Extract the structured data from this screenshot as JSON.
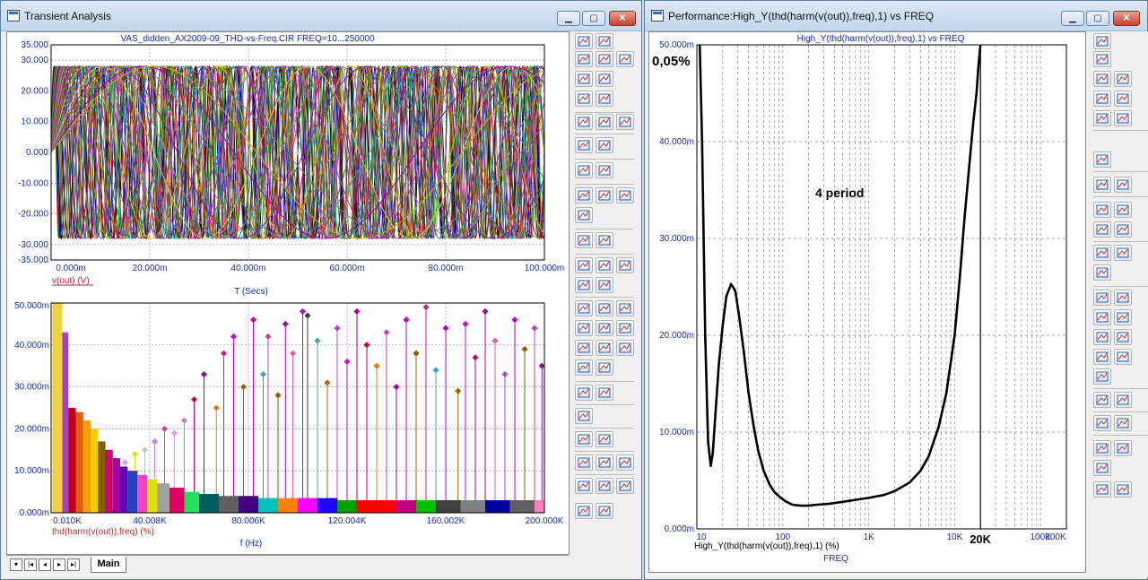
{
  "left_window": {
    "title": "Transient Analysis",
    "controls": {
      "minimize": "▁",
      "maximize": "▢",
      "close": "✕"
    },
    "tab_label": "Main"
  },
  "right_window": {
    "title": "Performance:High_Y(thd(harm(v(out)),freq),1) vs FREQ",
    "controls": {
      "minimize": "▁",
      "maximize": "▢",
      "close": "✕"
    }
  },
  "colors": {
    "axis_text": "#1d2ea8",
    "grid": "#888888",
    "trace_label": "#c0282f"
  },
  "chart_data": [
    {
      "id": "transient",
      "type": "line",
      "title": "VAS_didden_AX2009-09_THD-vs-Freq.CIR FREQ=10...250000",
      "xlabel": "T (Secs)",
      "ylabel": "",
      "trace_label": "v(out) (V)",
      "xlim": [
        0,
        100
      ],
      "ylim": [
        -35,
        35
      ],
      "x_tick_labels": [
        "0.000m",
        "20.000m",
        "40.000m",
        "60.000m",
        "80.000m",
        "100.000m"
      ],
      "y_tick_labels": [
        "35.000",
        "30.000",
        "20.000",
        "10.000",
        "0.000",
        "-10.000",
        "-20.000",
        "-30.000",
        "-35.000"
      ],
      "series": [
        {
          "color": "#00c000",
          "freq": 500,
          "amplitude": 28
        },
        {
          "color": "#e00000",
          "freq": 450,
          "amplitude": 28
        },
        {
          "color": "#0000e0",
          "freq": 400,
          "amplitude": 28
        },
        {
          "color": "#000000",
          "freq": 350,
          "amplitude": 28
        },
        {
          "color": "#606060",
          "freq": 300,
          "amplitude": 28
        },
        {
          "color": "#808000",
          "freq": 260,
          "amplitude": 28
        },
        {
          "color": "#1a1a1a",
          "freq": 220,
          "amplitude": 28
        },
        {
          "color": "#9a9a9a",
          "freq": 190,
          "amplitude": 28
        },
        {
          "color": "#6a6a6a",
          "freq": 165,
          "amplitude": 28
        },
        {
          "color": "#404040",
          "freq": 145,
          "amplitude": 28
        },
        {
          "color": "#a00040",
          "freq": 128,
          "amplitude": 28
        },
        {
          "color": "#20a0a0",
          "freq": 115,
          "amplitude": 28
        },
        {
          "color": "#c040c0",
          "freq": 103,
          "amplitude": 28
        },
        {
          "color": "#806000",
          "freq": 92,
          "amplitude": 28
        },
        {
          "color": "#e060a0",
          "freq": 82,
          "amplitude": 28
        },
        {
          "color": "#2060a0",
          "freq": 73,
          "amplitude": 28
        },
        {
          "color": "#c0a000",
          "freq": 65,
          "amplitude": 28
        },
        {
          "color": "#b000b0",
          "freq": 58,
          "amplitude": 28
        },
        {
          "color": "#c06000",
          "freq": 52,
          "amplitude": 28
        },
        {
          "color": "#00a060",
          "freq": 46,
          "amplitude": 28
        },
        {
          "color": "#a03080",
          "freq": 41,
          "amplitude": 28
        },
        {
          "color": "#c0c000",
          "freq": 37,
          "amplitude": 28
        },
        {
          "color": "#505090",
          "freq": 33,
          "amplitude": 28
        },
        {
          "color": "#3090b0",
          "freq": 29.5,
          "amplitude": 28
        },
        {
          "color": "#b030b0",
          "freq": 26.5,
          "amplitude": 28
        },
        {
          "color": "#d0d040",
          "freq": 24,
          "amplitude": 28
        },
        {
          "color": "#909090",
          "freq": 21.5,
          "amplitude": 28
        },
        {
          "color": "#6a3090",
          "freq": 19.5,
          "amplitude": 28
        },
        {
          "color": "#b08000",
          "freq": 17.5,
          "amplitude": 28
        },
        {
          "color": "#4a8aa0",
          "freq": 15.5,
          "amplitude": 28
        },
        {
          "color": "#a000a0",
          "freq": 13.5,
          "amplitude": 28
        },
        {
          "color": "#c8b400",
          "freq": 12,
          "amplitude": 28
        },
        {
          "color": "#808080",
          "freq": 10.5,
          "amplitude": 28
        }
      ]
    },
    {
      "id": "harmonics",
      "type": "bar",
      "title": "",
      "xlabel": "f (Hz)",
      "ylabel": "",
      "trace_label": "thd(harm(v(out)),freq) (%)",
      "xlim": [
        0,
        200
      ],
      "ylim": [
        0,
        50
      ],
      "x_tick_labels": [
        "0.010K",
        "40.008K",
        "80.006K",
        "120.004K",
        "160.002K",
        "200.000K"
      ],
      "y_tick_labels": [
        "50.000m",
        "40.000m",
        "30.000m",
        "20.000m",
        "10.000m",
        "0.000m"
      ],
      "bars": [
        {
          "x": 0.5,
          "value": 50,
          "color": "#f0d040"
        },
        {
          "x": 4.5,
          "value": 43,
          "color": "#a040d0"
        },
        {
          "x": 7,
          "value": 25,
          "color": "#c00020"
        },
        {
          "x": 10,
          "value": 24,
          "color": "#e06000"
        },
        {
          "x": 13,
          "value": 22,
          "color": "#f0a000"
        },
        {
          "x": 16,
          "value": 20,
          "color": "#f0d000"
        },
        {
          "x": 19,
          "value": 17,
          "color": "#806000"
        },
        {
          "x": 22,
          "value": 15,
          "color": "#d00070"
        },
        {
          "x": 25,
          "value": 13,
          "color": "#a000a0"
        },
        {
          "x": 28,
          "value": 11,
          "color": "#6000b0"
        },
        {
          "x": 31,
          "value": 10,
          "color": "#2040c0"
        },
        {
          "x": 35,
          "value": 9,
          "color": "#ff40c0"
        },
        {
          "x": 39,
          "value": 8,
          "color": "#e0e000"
        },
        {
          "x": 43,
          "value": 7,
          "color": "#a0a0a0"
        },
        {
          "x": 48,
          "value": 6,
          "color": "#e00060"
        },
        {
          "x": 54,
          "value": 5,
          "color": "#20e060"
        },
        {
          "x": 60,
          "value": 4.5,
          "color": "#006060"
        },
        {
          "x": 68,
          "value": 4,
          "color": "#606060"
        },
        {
          "x": 76,
          "value": 4,
          "color": "#400080"
        },
        {
          "x": 84,
          "value": 3.5,
          "color": "#00c0c0"
        },
        {
          "x": 92,
          "value": 3.5,
          "color": "#ff8000"
        },
        {
          "x": 100,
          "value": 3.5,
          "color": "#ff00ff"
        },
        {
          "x": 108,
          "value": 3.5,
          "color": "#2000ff"
        },
        {
          "x": 116,
          "value": 3,
          "color": "#00a000"
        },
        {
          "x": 124,
          "value": 3,
          "color": "#ff0000"
        },
        {
          "x": 132,
          "value": 3,
          "color": "#ff0000"
        },
        {
          "x": 140,
          "value": 3,
          "color": "#c00080"
        },
        {
          "x": 148,
          "value": 3,
          "color": "#00c000"
        },
        {
          "x": 156,
          "value": 3,
          "color": "#404040"
        },
        {
          "x": 166,
          "value": 3,
          "color": "#808080"
        },
        {
          "x": 176,
          "value": 3,
          "color": "#0000a0"
        },
        {
          "x": 186,
          "value": 3,
          "color": "#606060"
        },
        {
          "x": 196,
          "value": 3,
          "color": "#ff80c0"
        }
      ],
      "stems": [
        {
          "x": 58,
          "value": 27,
          "color": "#c00060"
        },
        {
          "x": 62,
          "value": 33,
          "color": "#a000a0"
        },
        {
          "x": 67,
          "value": 25,
          "color": "#e08000"
        },
        {
          "x": 70,
          "value": 38,
          "color": "#c02080"
        },
        {
          "x": 74,
          "value": 42,
          "color": "#d000d0"
        },
        {
          "x": 78,
          "value": 30,
          "color": "#a06000"
        },
        {
          "x": 82,
          "value": 46,
          "color": "#c000c0"
        },
        {
          "x": 86,
          "value": 33,
          "color": "#40a0c0"
        },
        {
          "x": 88,
          "value": 42,
          "color": "#d040a0"
        },
        {
          "x": 92,
          "value": 28,
          "color": "#806000"
        },
        {
          "x": 95,
          "value": 45,
          "color": "#a000a0"
        },
        {
          "x": 98,
          "value": 38,
          "color": "#e060a0"
        },
        {
          "x": 102,
          "value": 48,
          "color": "#c000c0"
        },
        {
          "x": 104,
          "value": 47,
          "color": "#404040"
        },
        {
          "x": 108,
          "value": 41,
          "color": "#40a0c0"
        },
        {
          "x": 112,
          "value": 31,
          "color": "#c06000"
        },
        {
          "x": 116,
          "value": 44,
          "color": "#c040c0"
        },
        {
          "x": 120,
          "value": 36,
          "color": "#d000d0"
        },
        {
          "x": 124,
          "value": 48,
          "color": "#a000a0"
        },
        {
          "x": 128,
          "value": 40,
          "color": "#c00060"
        },
        {
          "x": 132,
          "value": 35,
          "color": "#e08000"
        },
        {
          "x": 136,
          "value": 43,
          "color": "#d040a0"
        },
        {
          "x": 140,
          "value": 30,
          "color": "#a000a0"
        },
        {
          "x": 144,
          "value": 46,
          "color": "#c000c0"
        },
        {
          "x": 148,
          "value": 38,
          "color": "#806000"
        },
        {
          "x": 152,
          "value": 49,
          "color": "#c02080"
        },
        {
          "x": 156,
          "value": 34,
          "color": "#40a0c0"
        },
        {
          "x": 160,
          "value": 44,
          "color": "#c000c0"
        },
        {
          "x": 165,
          "value": 29,
          "color": "#a06000"
        },
        {
          "x": 168,
          "value": 45,
          "color": "#d000d0"
        },
        {
          "x": 172,
          "value": 37,
          "color": "#c00060"
        },
        {
          "x": 176,
          "value": 48,
          "color": "#a000a0"
        },
        {
          "x": 180,
          "value": 41,
          "color": "#e060a0"
        },
        {
          "x": 184,
          "value": 33,
          "color": "#c040c0"
        },
        {
          "x": 188,
          "value": 46,
          "color": "#c000c0"
        },
        {
          "x": 192,
          "value": 39,
          "color": "#806000"
        },
        {
          "x": 196,
          "value": 44,
          "color": "#d040a0"
        },
        {
          "x": 199,
          "value": 35,
          "color": "#a000a0"
        },
        {
          "x": 22,
          "value": 13,
          "color": "#d080d0"
        },
        {
          "x": 30,
          "value": 12,
          "color": "#e0a0e0"
        },
        {
          "x": 34,
          "value": 14,
          "color": "#e0e000"
        },
        {
          "x": 38,
          "value": 15,
          "color": "#c0c0c0"
        },
        {
          "x": 42,
          "value": 17,
          "color": "#d080d0"
        },
        {
          "x": 46,
          "value": 20,
          "color": "#d040a0"
        },
        {
          "x": 50,
          "value": 19,
          "color": "#e0a0e0"
        },
        {
          "x": 54,
          "value": 22,
          "color": "#c080c0"
        }
      ]
    },
    {
      "id": "performance",
      "type": "line",
      "title": "High_Y(thd(harm(v(out)),freq),1) vs FREQ",
      "xlabel": "FREQ",
      "ylabel": "",
      "trace_label": "High_Y(thd(harm(v(out)),freq),1) (%)",
      "x_scale": "log",
      "xlim": [
        10,
        200000
      ],
      "ylim": [
        0,
        50
      ],
      "x_tick_labels": [
        "10",
        "100",
        "1K",
        "10K",
        "100K",
        "200K"
      ],
      "y_tick_labels": [
        "50.000m",
        "40.000m",
        "30.000m",
        "20.000m",
        "10.000m",
        "0.000m"
      ],
      "annotations": {
        "top_left": "0,05%",
        "middle": "4 period",
        "marker": "20K"
      },
      "marker_x": 20000,
      "x": [
        10.8,
        11.5,
        12.5,
        13.5,
        14.5,
        15.3,
        16.5,
        18,
        20,
        22,
        25,
        28,
        31,
        35,
        40,
        46,
        52,
        60,
        70,
        80,
        95,
        110,
        130,
        160,
        200,
        250,
        350,
        500,
        700,
        1000,
        1500,
        2000,
        3000,
        4000,
        5000,
        6500,
        8000,
        10000,
        11500,
        13000,
        15000,
        16500,
        18000,
        19000,
        20000
      ],
      "y": [
        50,
        40,
        20,
        9,
        6.5,
        7.8,
        12,
        17,
        21,
        24,
        25.3,
        24.6,
        22,
        18.5,
        14,
        10.5,
        8,
        6,
        4.6,
        3.8,
        3.2,
        2.8,
        2.5,
        2.4,
        2.4,
        2.5,
        2.6,
        2.8,
        3.0,
        3.2,
        3.5,
        3.9,
        4.8,
        6,
        7.5,
        10.5,
        14,
        20,
        26,
        32,
        38,
        42,
        45,
        48,
        50
      ]
    }
  ]
}
